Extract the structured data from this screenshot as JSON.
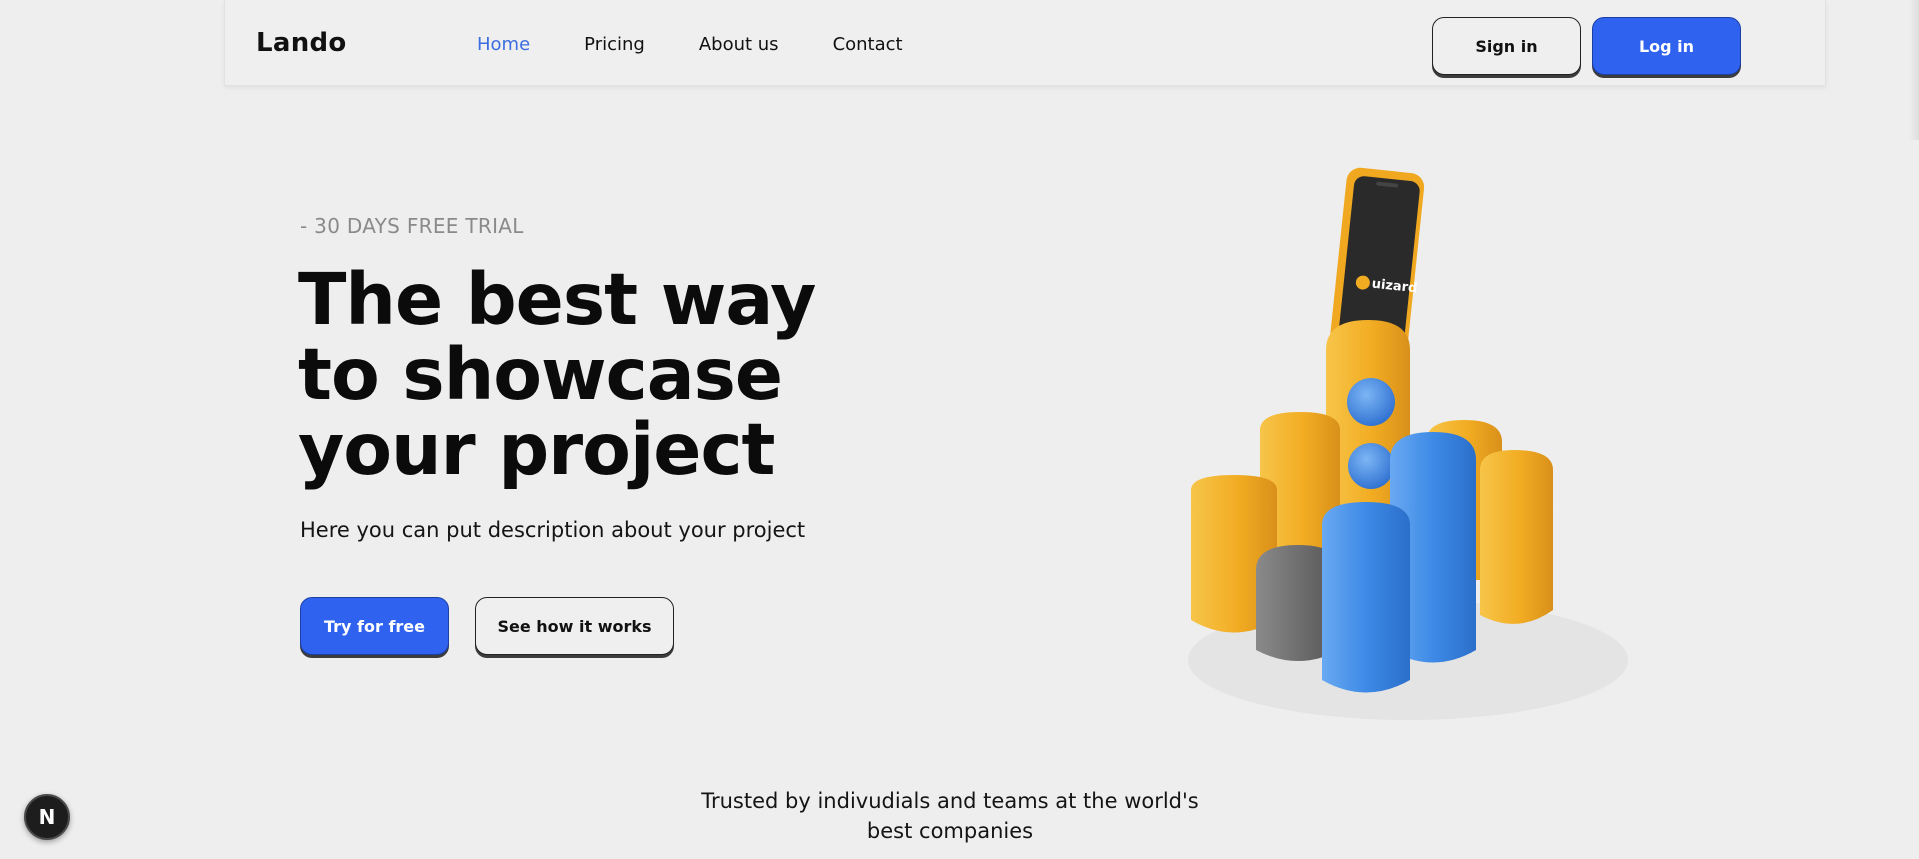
{
  "nav": {
    "brand": "Lando",
    "links": [
      {
        "label": "Home",
        "active": true
      },
      {
        "label": "Pricing",
        "active": false
      },
      {
        "label": "About us",
        "active": false
      },
      {
        "label": "Contact",
        "active": false
      }
    ],
    "signin_label": "Sign in",
    "login_label": "Log in"
  },
  "hero": {
    "eyebrow": "- 30 DAYS FREE TRIAL",
    "headline_line1": "The best way",
    "headline_line2": "to showcase",
    "headline_line3": "your project",
    "description": "Here you can put description about your project",
    "primary_cta": "Try for free",
    "secondary_cta": "See how it works",
    "illustration": {
      "phone_logo_text": "uizard"
    }
  },
  "trusted": {
    "line1": "Trusted by indivudials and teams at the world's",
    "line2": "best companies"
  },
  "floating_badge": {
    "letter": "N"
  },
  "colors": {
    "accent": "#2f63ef",
    "active_link": "#3b6de0",
    "background": "#eeeeee",
    "illustration_yellow": "#f4b12a",
    "illustration_blue": "#3f8ee6",
    "illustration_gray": "#6b6b6b"
  }
}
